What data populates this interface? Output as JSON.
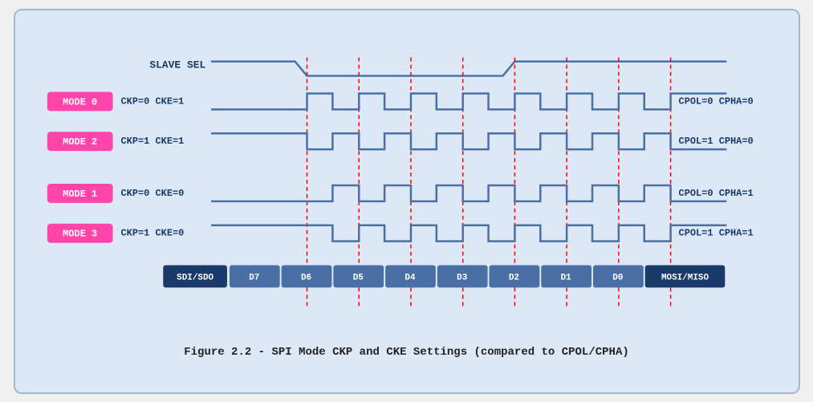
{
  "caption": "Figure 2.2 - SPI Mode CKP and CKE Settings (compared to CPOL/CPHA)",
  "diagram": {
    "slave_sel_label": "SLAVE SEL",
    "modes": [
      {
        "mode": "MODE 0",
        "params": "CKP=0  CKE=1",
        "right": "CPOL=0  CPHA=0"
      },
      {
        "mode": "MODE 2",
        "params": "CKP=1  CKE=1",
        "right": "CPOL=1  CPHA=0"
      },
      {
        "mode": "MODE 1",
        "params": "CKP=0  CKE=0",
        "right": "CPOL=0  CPHA=1"
      },
      {
        "mode": "MODE 3",
        "params": "CKP=1  CKE=0",
        "right": "CPOL=1  CPHA=1"
      }
    ],
    "data_bits": [
      "SDI/SDO",
      "D7",
      "D6",
      "D5",
      "D4",
      "D3",
      "D2",
      "D1",
      "D0",
      "MOSI/MISO"
    ]
  }
}
